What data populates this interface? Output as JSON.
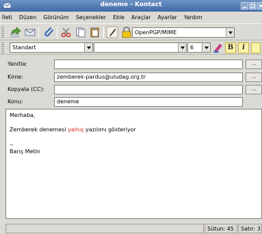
{
  "window": {
    "title": "deneme - Kontact"
  },
  "menu": [
    "İleti",
    "Düzen",
    "Görünüm",
    "Seçenekler",
    "Ekle",
    "Araçlar",
    "Ayarlar",
    "Yardım"
  ],
  "toolbar": {
    "encryption_format": "OpenPGP/MIME",
    "icons": [
      "send-icon",
      "queue-icon",
      "attach-icon",
      "cut-icon",
      "copy-icon",
      "paste-icon",
      "sign-icon",
      "encrypt-lock-icon"
    ]
  },
  "format": {
    "style": "Standart",
    "font": "",
    "size": "6",
    "bold_label": "B",
    "italic_label": "i",
    "icons": [
      "text-color-icon",
      "bold-icon",
      "italic-icon"
    ]
  },
  "fields": {
    "reply_to": {
      "label": "Yanıtla:",
      "value": ""
    },
    "to": {
      "label": "Kime:",
      "value": "zemberek-pardus@uludag.org.tr"
    },
    "cc": {
      "label": "Kopyala (CC):",
      "value": ""
    },
    "subject": {
      "label": "Konu:",
      "value": "deneme"
    },
    "browse_label": "..."
  },
  "body": {
    "greeting": "Merhaba,",
    "line_before": "Zemberek denemesi ",
    "misspelled_word": "yalnış",
    "line_after": " yazılımı gösteriyor",
    "signature_sep": "--",
    "signature_name": "Barış Metin"
  },
  "status": {
    "column": "Sütun: 45",
    "row": "Satır: 3"
  },
  "colors": {
    "titlebar": "#4f77b0",
    "misspelling": "#d32020",
    "window_bg": "#dcdad5"
  }
}
